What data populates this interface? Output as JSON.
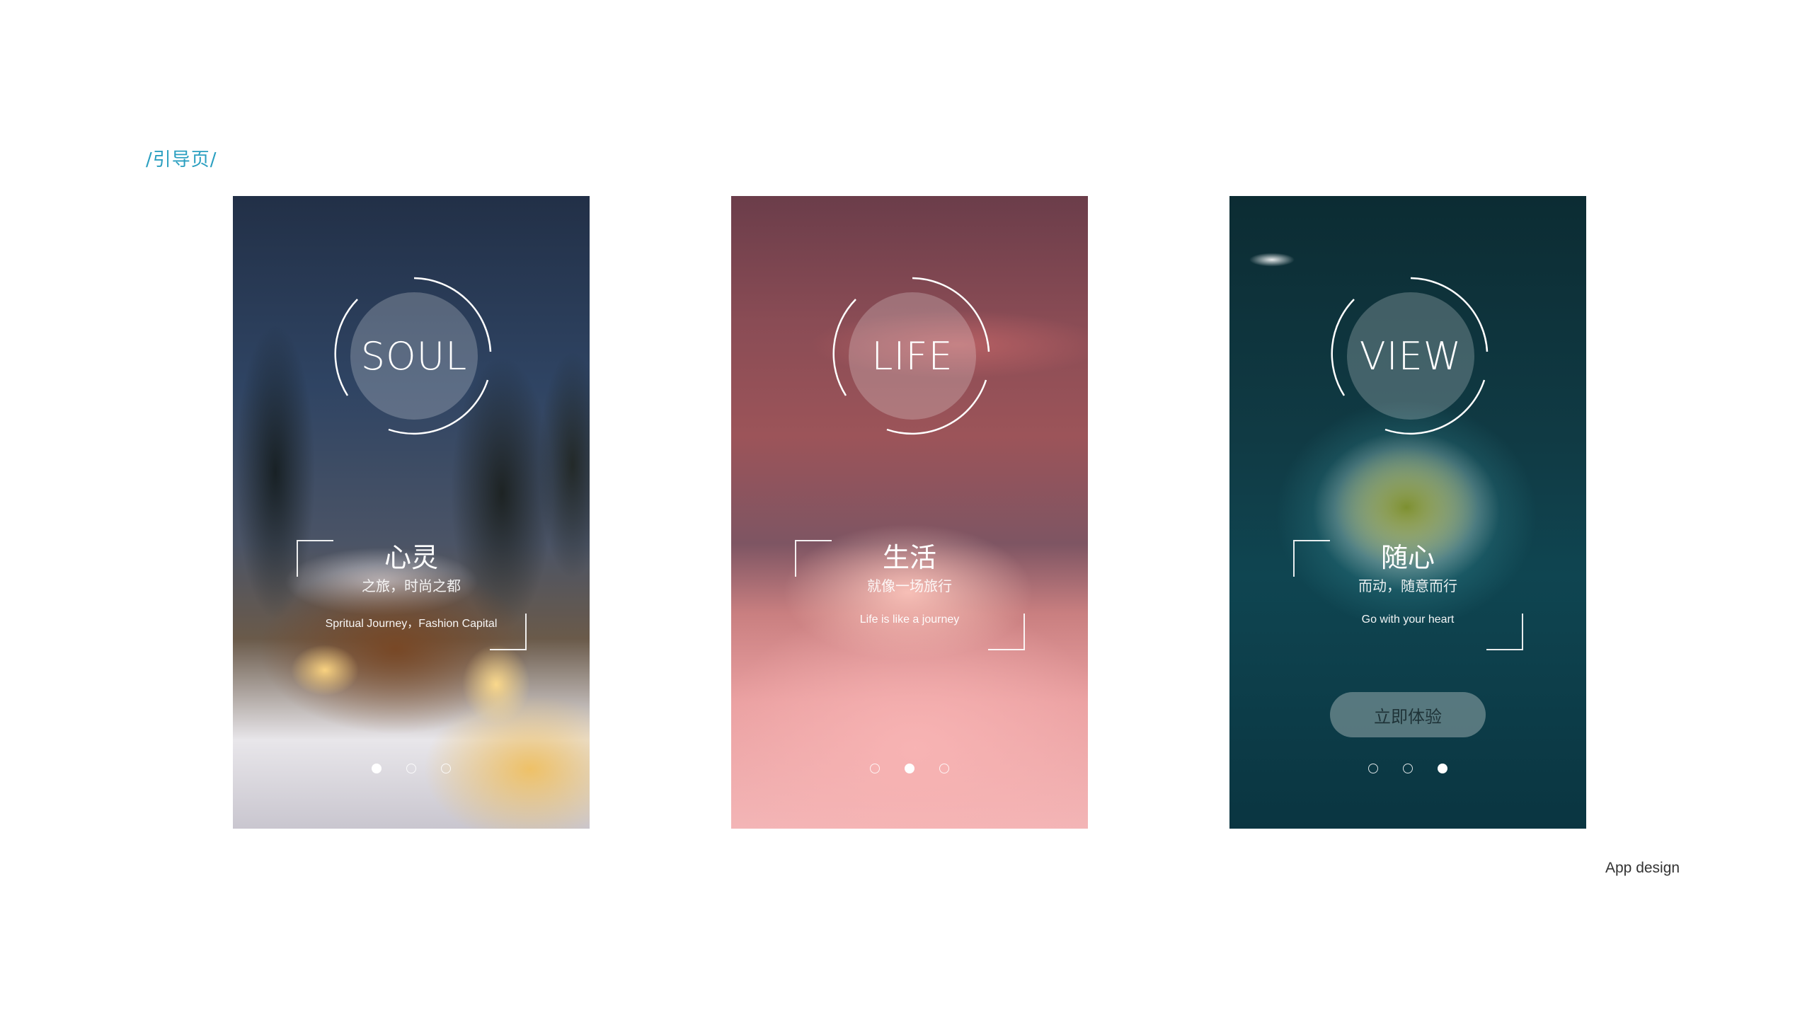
{
  "section_title": "/引导页/",
  "footer_note": "App design",
  "colors": {
    "section_title": "#2a9fc0",
    "page_background": "#ffffff"
  },
  "screens": [
    {
      "word": "SOUL",
      "title": "心灵",
      "subtitle": "之旅，时尚之都",
      "english": "Spritual Journey，Fashion Capital",
      "background": "snowy cabin at night",
      "page_indicator": {
        "current": 1,
        "total": 3
      }
    },
    {
      "word": "LIFE",
      "title": "生活",
      "subtitle": "就像一场旅行",
      "english": "Life is like a journey",
      "background": "pink snowy mountain peak",
      "page_indicator": {
        "current": 2,
        "total": 3
      }
    },
    {
      "word": "VIEW",
      "title": "随心",
      "subtitle": "而动，随意而行",
      "english": "Go with your heart",
      "cta_label": "立即体验",
      "background": "aerial island in teal sea",
      "page_indicator": {
        "current": 3,
        "total": 3
      }
    }
  ]
}
